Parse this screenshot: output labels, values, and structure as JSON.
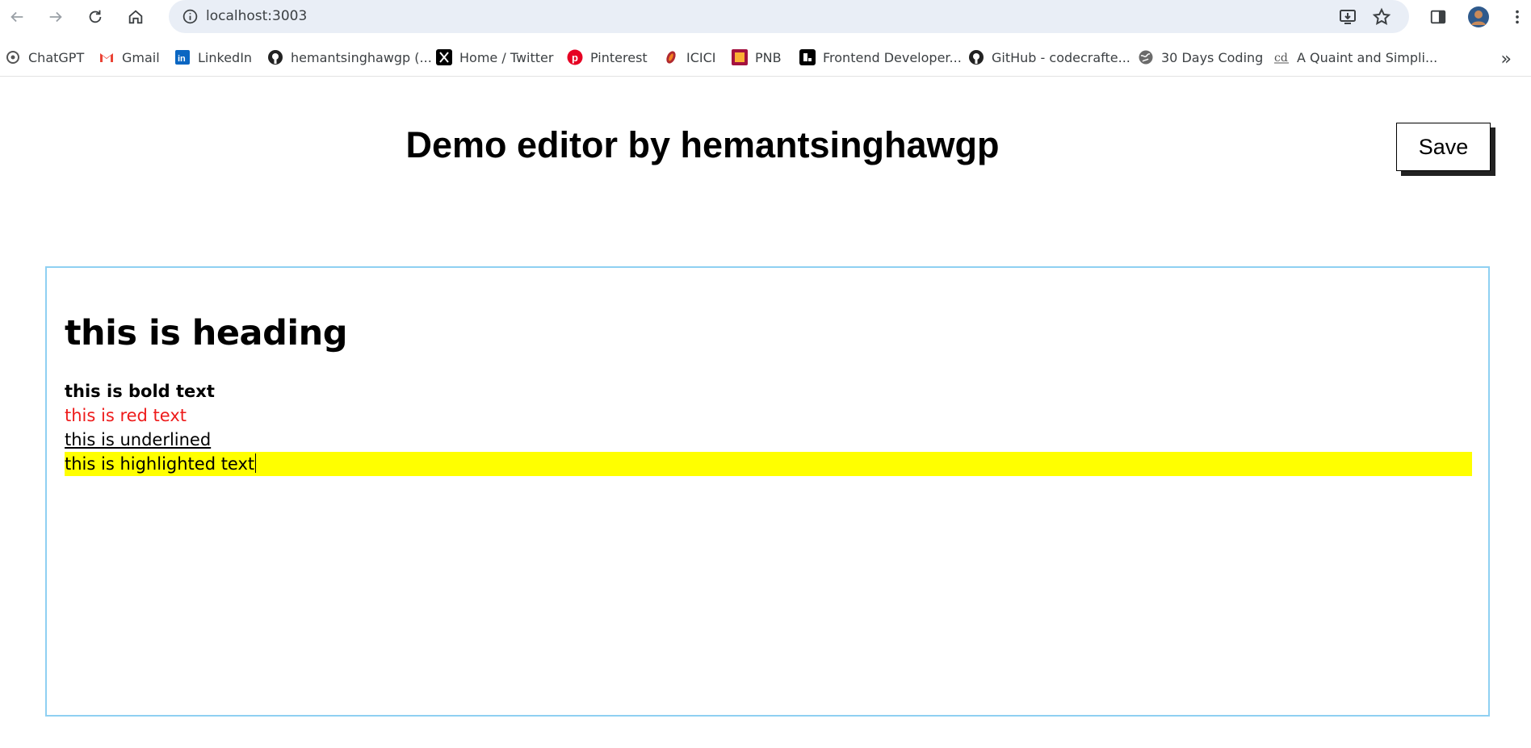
{
  "browser": {
    "url": "localhost:3003",
    "bookmarks": [
      {
        "label": "ChatGPT",
        "icon": "chatgpt-icon"
      },
      {
        "label": "Gmail",
        "icon": "gmail-icon"
      },
      {
        "label": "LinkedIn",
        "icon": "linkedin-icon"
      },
      {
        "label": "hemantsinghawgp (...",
        "icon": "github-icon"
      },
      {
        "label": "Home / Twitter",
        "icon": "x-icon"
      },
      {
        "label": "Pinterest",
        "icon": "pinterest-icon"
      },
      {
        "label": "ICICI",
        "icon": "icici-icon"
      },
      {
        "label": "PNB",
        "icon": "pnb-icon"
      },
      {
        "label": "Frontend Developer...",
        "icon": "frontend-icon"
      },
      {
        "label": "GitHub - codecrafte...",
        "icon": "github-icon"
      },
      {
        "label": "30 Days Coding",
        "icon": "globe-icon"
      },
      {
        "label": "A Quaint and Simpli...",
        "icon": "cd-icon"
      }
    ],
    "more_bookmarks": "»"
  },
  "page": {
    "title": "Demo editor by hemantsinghawgp",
    "save_label": "Save"
  },
  "editor": {
    "heading": "this is heading",
    "bold_text": "this is bold text",
    "red_text": "this is red text",
    "underlined_text": "this is underlined",
    "highlighted_text": "this is highlighted text"
  },
  "colors": {
    "editor_border": "#8fd0f2",
    "red_text": "#ee1b1b",
    "highlight": "#ffff00"
  }
}
